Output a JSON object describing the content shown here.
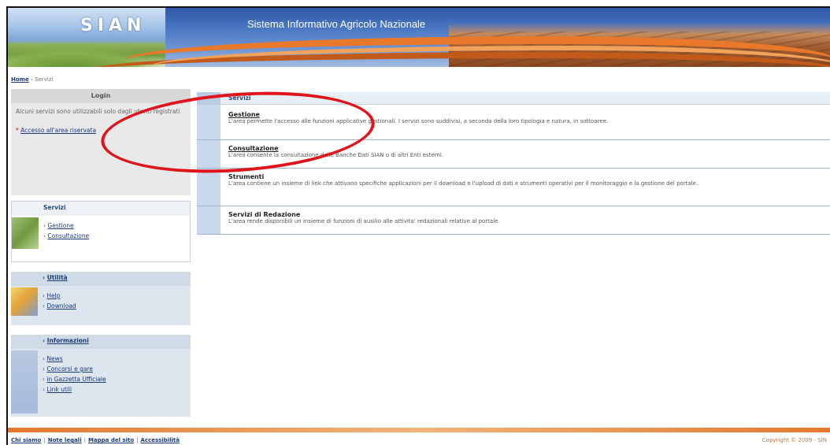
{
  "header": {
    "logo_text": "SIAN",
    "subtitle": "Sistema Informativo Agricolo Nazionale"
  },
  "breadcrumb": {
    "home": "Home",
    "separator": "›",
    "current": "Servizi"
  },
  "login": {
    "title": "Login",
    "message": "Alcuni servizi sono utilizzabili solo dagli utenti registrati",
    "link": "Accesso all'area riservata"
  },
  "sidebar": {
    "servizi": {
      "title": "Servizi",
      "items": [
        "Gestione",
        "Consultazione"
      ]
    },
    "utilita": {
      "title": "Utilità",
      "items": [
        "Help",
        "Download"
      ]
    },
    "informazioni": {
      "title": "Informazioni",
      "items": [
        "News",
        "Concorsi e gare",
        "in Gazzetta Ufficiale",
        "Link utili"
      ]
    }
  },
  "main": {
    "section_title": "Servizi",
    "services": [
      {
        "title": "Gestione",
        "description": "L'area permette l'accesso alle funzioni applicative gestionali. I servizi sono suddivisi, a seconda della loro tipologia e natura, in sottoaree."
      },
      {
        "title": "Consultazione",
        "description": "L'area consente la consultazione delle Banche Dati SIAN o di altri Enti esterni."
      },
      {
        "title": "Strumenti",
        "description": "L'area contiene un insieme di link che attivano specifiche applicazioni per il download e l'upload di dati e strumenti operativi per il monitoraggio e la gestione del portale."
      },
      {
        "title": "Servizi di Redazione",
        "description": "L'area rende disponibili un insieme di funzioni di ausilio alle attivita' redazionali relative al portale."
      }
    ]
  },
  "footer": {
    "links": [
      "Chi siamo",
      "Note legali",
      "Mappa del sito",
      "Accessibilità"
    ],
    "copyright": "Copyright © 2009 - SIN"
  },
  "colors": {
    "annotation": "#e0141b",
    "accent_orange": "#e8782a",
    "link_blue": "#1a3a7a"
  }
}
